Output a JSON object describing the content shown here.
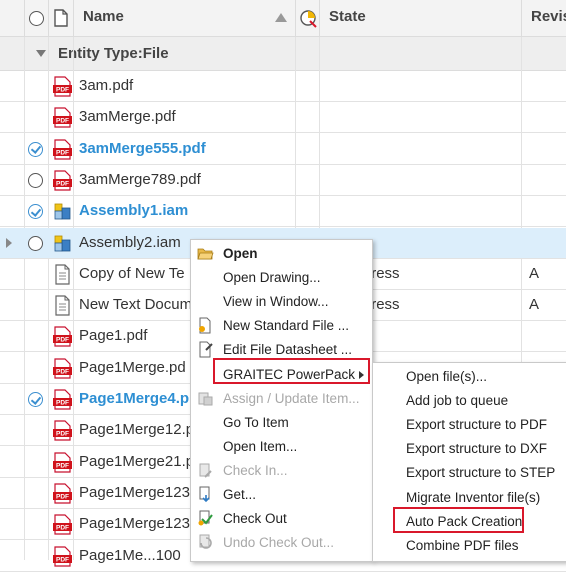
{
  "header": {
    "name_label": "Name",
    "state_label": "State",
    "revision_label": "Revis"
  },
  "group": {
    "label": "Entity Type:File"
  },
  "rows": [
    {
      "name": "3am.pdf",
      "type": "pdf",
      "checked": false,
      "circle": false,
      "bold": false,
      "state": "",
      "rev": ""
    },
    {
      "name": "3amMerge.pdf",
      "type": "pdf",
      "checked": false,
      "circle": false,
      "bold": false,
      "state": "",
      "rev": ""
    },
    {
      "name": "3amMerge555.pdf",
      "type": "pdf",
      "checked": true,
      "circle": true,
      "bold": true,
      "state": "",
      "rev": ""
    },
    {
      "name": "3amMerge789.pdf",
      "type": "pdf",
      "checked": false,
      "circle": true,
      "bold": false,
      "state": "",
      "rev": ""
    },
    {
      "name": "Assembly1.iam",
      "type": "iam",
      "checked": true,
      "circle": true,
      "bold": true,
      "state": "",
      "rev": ""
    },
    {
      "name": "Assembly2.iam",
      "type": "iam",
      "checked": false,
      "circle": true,
      "bold": false,
      "state": "",
      "rev": ""
    },
    {
      "name": "Copy of New Te",
      "type": "txt",
      "checked": false,
      "circle": false,
      "bold": false,
      "state": "n Progress",
      "rev": "A"
    },
    {
      "name": "New Text Docum",
      "type": "txt",
      "checked": false,
      "circle": false,
      "bold": false,
      "state": "n Progress",
      "rev": "A"
    },
    {
      "name": "Page1.pdf",
      "type": "pdf",
      "checked": false,
      "circle": false,
      "bold": false,
      "state": "",
      "rev": ""
    },
    {
      "name": "Page1Merge.pd",
      "type": "pdf",
      "checked": false,
      "circle": false,
      "bold": false,
      "state": "",
      "rev": ""
    },
    {
      "name": "Page1Merge4.p",
      "type": "pdf",
      "checked": true,
      "circle": true,
      "bold": true,
      "state": "",
      "rev": ""
    },
    {
      "name": "Page1Merge12.p",
      "type": "pdf",
      "checked": false,
      "circle": false,
      "bold": false,
      "state": "",
      "rev": ""
    },
    {
      "name": "Page1Merge21.p",
      "type": "pdf",
      "checked": false,
      "circle": false,
      "bold": false,
      "state": "",
      "rev": ""
    },
    {
      "name": "Page1Merge123.",
      "type": "pdf",
      "checked": false,
      "circle": false,
      "bold": false,
      "state": "",
      "rev": ""
    },
    {
      "name": "Page1Merge123",
      "type": "pdf",
      "checked": false,
      "circle": false,
      "bold": false,
      "state": "",
      "rev": ""
    },
    {
      "name": "Page1Me...100",
      "type": "pdf",
      "checked": false,
      "circle": false,
      "bold": false,
      "state": "",
      "rev": ""
    }
  ],
  "context_menu": {
    "items": [
      {
        "label": "Open",
        "bold": true,
        "disabled": false,
        "icon": "folder-open-icon"
      },
      {
        "label": "Open Drawing...",
        "bold": false,
        "disabled": false,
        "icon": ""
      },
      {
        "label": "View in Window...",
        "bold": false,
        "disabled": false,
        "icon": ""
      },
      {
        "label": "New Standard File ...",
        "bold": false,
        "disabled": false,
        "icon": "new-file-icon"
      },
      {
        "label": "Edit File Datasheet ...",
        "bold": false,
        "disabled": false,
        "icon": "datasheet-icon"
      },
      {
        "label": "GRAITEC PowerPack",
        "bold": false,
        "disabled": false,
        "icon": "",
        "submenu": true
      },
      {
        "label": "Assign / Update Item...",
        "bold": false,
        "disabled": true,
        "icon": "assign-item-icon"
      },
      {
        "label": "Go To Item",
        "bold": false,
        "disabled": false,
        "icon": ""
      },
      {
        "label": "Open Item...",
        "bold": false,
        "disabled": false,
        "icon": ""
      },
      {
        "label": "Check In...",
        "bold": false,
        "disabled": true,
        "icon": "check-in-icon"
      },
      {
        "label": "Get...",
        "bold": false,
        "disabled": false,
        "icon": "get-icon"
      },
      {
        "label": "Check Out",
        "bold": false,
        "disabled": false,
        "icon": "check-out-icon"
      },
      {
        "label": "Undo Check Out...",
        "bold": false,
        "disabled": true,
        "icon": "undo-check-out-icon"
      }
    ]
  },
  "submenu": {
    "items": [
      {
        "label": "Open file(s)..."
      },
      {
        "label": "Add job to queue"
      },
      {
        "label": "Export structure to PDF"
      },
      {
        "label": "Export structure to DXF"
      },
      {
        "label": "Export structure to STEP"
      },
      {
        "label": "Migrate Inventor file(s)"
      },
      {
        "label": "Auto Pack Creation"
      },
      {
        "label": "Combine PDF files"
      }
    ]
  },
  "colors": {
    "highlight_red": "#d9182b",
    "link_blue": "#2e8fd3",
    "selected_row": "#dceefb"
  }
}
